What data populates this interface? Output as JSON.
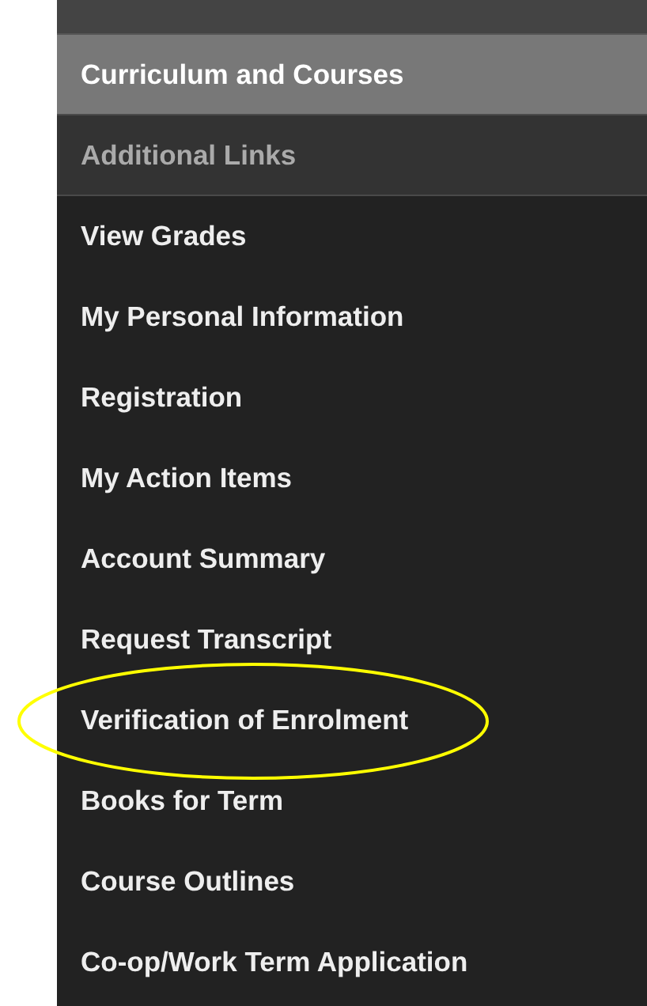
{
  "sections": [
    {
      "label": "Curriculum and Courses",
      "selected": true
    },
    {
      "label": "Additional Links",
      "selected": false
    }
  ],
  "links": [
    {
      "label": "View Grades",
      "circled": false
    },
    {
      "label": "My Personal Information",
      "circled": false
    },
    {
      "label": "Registration",
      "circled": false
    },
    {
      "label": "My Action Items",
      "circled": false
    },
    {
      "label": "Account Summary",
      "circled": false
    },
    {
      "label": "Request Transcript",
      "circled": false
    },
    {
      "label": "Verification of Enrolment",
      "circled": true
    },
    {
      "label": "Books for Term",
      "circled": false
    },
    {
      "label": "Course Outlines",
      "circled": false
    },
    {
      "label": "Co-op/Work Term Application",
      "circled": false
    }
  ]
}
